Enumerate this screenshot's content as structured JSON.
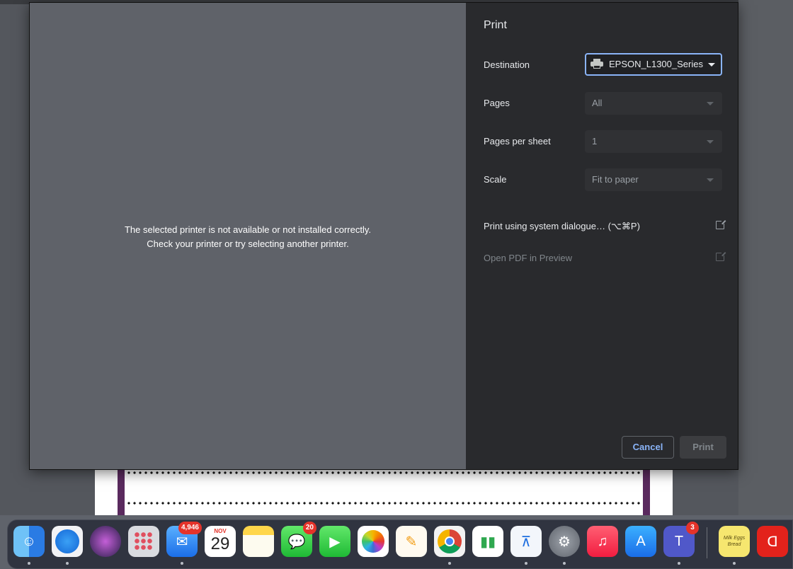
{
  "dialog": {
    "title": "Print",
    "preview_message_line1": "The selected printer is not available or not installed correctly.",
    "preview_message_line2": "Check your printer or try selecting another printer.",
    "destination": {
      "label": "Destination",
      "value": "EPSON_L1300_Series"
    },
    "pages": {
      "label": "Pages",
      "value": "All"
    },
    "pages_per_sheet": {
      "label": "Pages per sheet",
      "value": "1"
    },
    "scale": {
      "label": "Scale",
      "value": "Fit to paper"
    },
    "system_dialog_link": "Print using system dialogue… (⌥⌘P)",
    "open_pdf_link": "Open PDF in Preview",
    "cancel_label": "Cancel",
    "print_label": "Print",
    "accent_color": "#8ab4f8"
  },
  "dock": {
    "apps": [
      {
        "name": "Finder",
        "icon": "finder-icon"
      },
      {
        "name": "Safari",
        "icon": "safari-icon"
      },
      {
        "name": "Siri",
        "icon": "siri-icon"
      },
      {
        "name": "Launchpad",
        "icon": "launchpad-icon"
      },
      {
        "name": "Mail",
        "icon": "mail-icon",
        "badge": "4,946"
      },
      {
        "name": "Calendar",
        "icon": "calendar-icon",
        "month": "NOV",
        "day": "29"
      },
      {
        "name": "Notes",
        "icon": "notes-icon"
      },
      {
        "name": "Messages",
        "icon": "messages-icon",
        "badge": "20"
      },
      {
        "name": "FaceTime",
        "icon": "facetime-icon"
      },
      {
        "name": "Photos",
        "icon": "photos-icon"
      },
      {
        "name": "Pages",
        "icon": "pages-icon"
      },
      {
        "name": "Chrome",
        "icon": "chrome-icon"
      },
      {
        "name": "Numbers",
        "icon": "numbers-icon"
      },
      {
        "name": "Keynote",
        "icon": "keynote-icon"
      },
      {
        "name": "System Preferences",
        "icon": "settings-icon"
      },
      {
        "name": "Music",
        "icon": "music-icon"
      },
      {
        "name": "App Store",
        "icon": "app-store-icon"
      },
      {
        "name": "Teams",
        "icon": "teams-icon",
        "badge": "3"
      },
      {
        "name": "Stickies",
        "icon": "stickies-icon",
        "note_text": "Milk Eggs Bread"
      },
      {
        "name": "Acrobat",
        "icon": "acrobat-icon"
      }
    ]
  }
}
